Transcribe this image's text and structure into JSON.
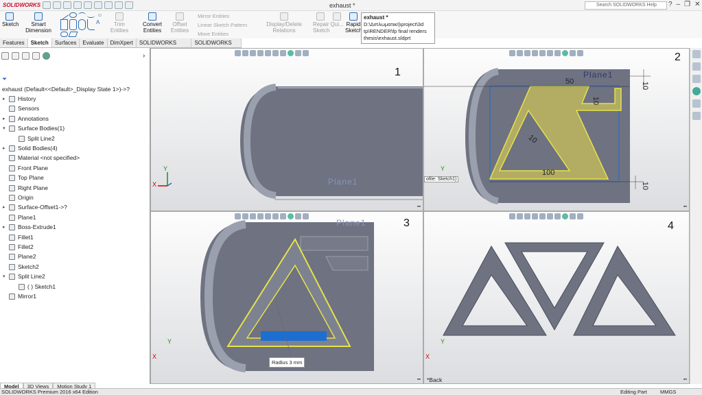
{
  "app": {
    "logo": "SOLIDWORKS",
    "title": "exhaust *",
    "search_placeholder": "Search SOLIDWORKS Help",
    "window_controls": [
      "?",
      "–",
      "❐",
      "✕"
    ]
  },
  "ribbon": {
    "sketch": "Sketch",
    "smart_dimension_1": "Smart",
    "smart_dimension_2": "Dimension",
    "trim": "Trim Entities",
    "convert": "Convert Entities",
    "offset_1": "Offset",
    "offset_2": "Entities",
    "mirror": "Mirror Entities",
    "linear_pattern": "Linear Sketch Pattern",
    "move": "Move Entities",
    "display_delete": "Display/Delete Relations",
    "repair_1": "Repair",
    "repair_2": "Sketch",
    "quick": "Qui...",
    "rapid_1": "Rapid",
    "rapid_2": "Sketch"
  },
  "tooltip": {
    "title": "exhaust *",
    "line1": "D:\\Διπλωματική\\project\\3d",
    "line2": "tp\\RENDER\\fp final renders",
    "line3": "thesis\\exhaust.sldprt"
  },
  "tabs": [
    "Features",
    "Sketch",
    "Surfaces",
    "Evaluate",
    "DimXpert",
    "SOLIDWORKS Add-Ins",
    "SOLIDWORKS MBD"
  ],
  "tree": {
    "root": "exhaust  (Default<<Default>_Display State 1>)->?",
    "items": [
      {
        "label": "History",
        "ex": "▸"
      },
      {
        "label": "Sensors",
        "ex": ""
      },
      {
        "label": "Annotations",
        "ex": "▸"
      },
      {
        "label": "Surface Bodies(1)",
        "ex": "▾"
      },
      {
        "label": "Split Line2",
        "ex": ""
      },
      {
        "label": "Solid Bodies(4)",
        "ex": "▸"
      },
      {
        "label": "Material <not specified>",
        "ex": ""
      },
      {
        "label": "Front Plane",
        "ex": ""
      },
      {
        "label": "Top Plane",
        "ex": ""
      },
      {
        "label": "Right Plane",
        "ex": ""
      },
      {
        "label": "Origin",
        "ex": ""
      },
      {
        "label": "Surface-Offset1->?",
        "ex": "▸"
      },
      {
        "label": "Plane1",
        "ex": ""
      },
      {
        "label": "Boss-Extrude1",
        "ex": "▸"
      },
      {
        "label": "Fillet1",
        "ex": ""
      },
      {
        "label": "Fillet2",
        "ex": ""
      },
      {
        "label": "Plane2",
        "ex": ""
      },
      {
        "label": "Sketch2",
        "ex": ""
      },
      {
        "label": "Split Line2",
        "ex": "▾"
      },
      {
        "label": "( ) Sketch1",
        "ex": ""
      },
      {
        "label": "Mirror1",
        "ex": ""
      }
    ]
  },
  "viewports": {
    "v1": {
      "number": "1",
      "plane_label": "Plane1"
    },
    "v2": {
      "number": "2",
      "plane_label": "Plane1",
      "dim_50": "50",
      "dim_10a": "10",
      "dim_10b": "10",
      "dim_10c": "10",
      "dim_100": "100",
      "dim_10d": "10",
      "profile_tip": "ofile: Sketch1)"
    },
    "v3": {
      "number": "3",
      "plane_label": "Plane1",
      "radius_label": "Radius",
      "radius_value": "3 mm"
    },
    "v4": {
      "number": "4",
      "back_label": "*Back"
    }
  },
  "axes": {
    "x": "X",
    "y": "Y"
  },
  "bottom_tabs": [
    "Model",
    "3D Views",
    "Motion Study 1"
  ],
  "status": {
    "left": "SOLIDWORKS Premium 2016 x64 Edition",
    "editing": "Editing Part",
    "units": "MMGS"
  },
  "colors": {
    "part": "#6e7281",
    "part_light": "#9aa0ae",
    "sketch_yellow": "#e8e24a",
    "highlight_blue": "#1c6fd0",
    "brand_red": "#c8102e"
  }
}
